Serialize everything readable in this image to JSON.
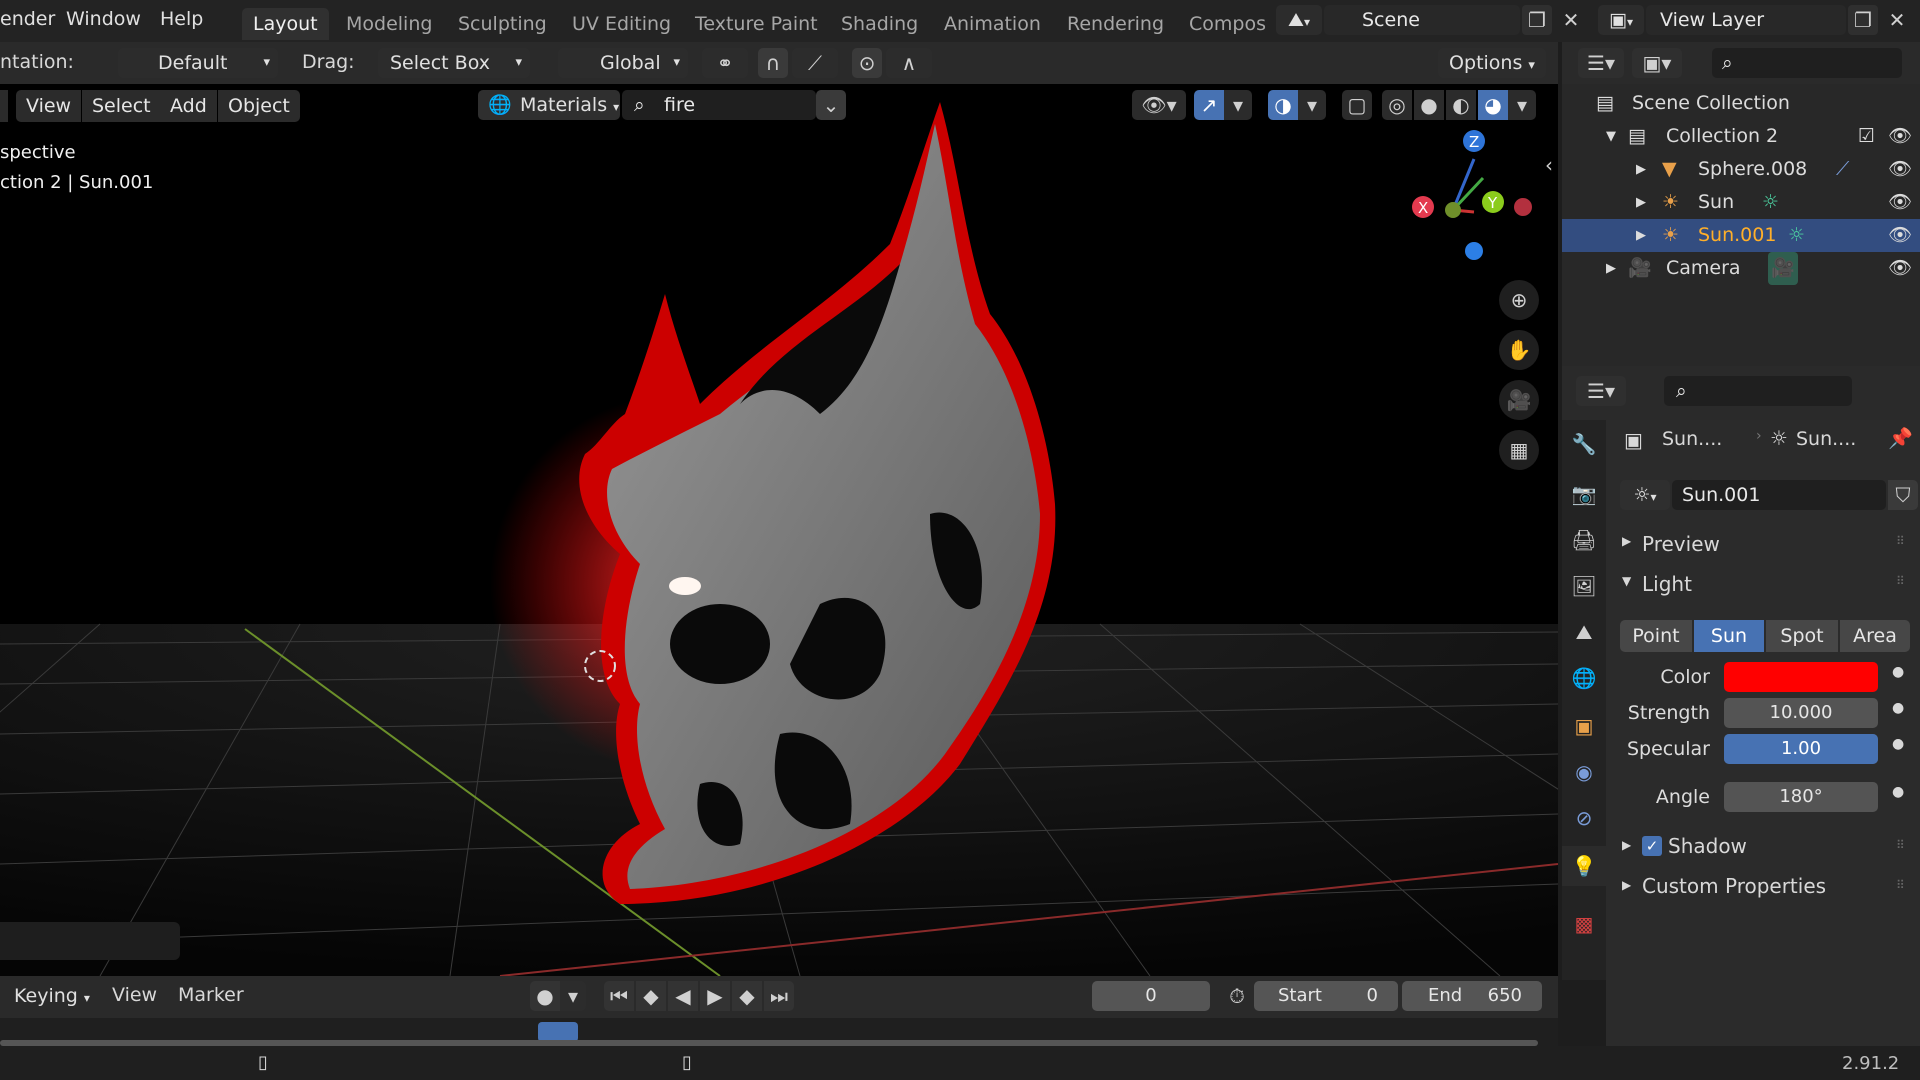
{
  "menu": {
    "render": "ender",
    "window": "Window",
    "help": "Help"
  },
  "workspaces": [
    "Layout",
    "Modeling",
    "Sculpting",
    "UV Editing",
    "Texture Paint",
    "Shading",
    "Animation",
    "Rendering",
    "Compos"
  ],
  "scene": {
    "label": "Scene"
  },
  "view_layer": {
    "label": "View Layer"
  },
  "toolbar": {
    "orientation_label": "ntation:",
    "orientation_value": "Default",
    "drag_label": "Drag:",
    "drag_value": "Select Box",
    "transform": "Global",
    "options": "Options"
  },
  "viewport_header": {
    "view": "View",
    "select": "Select",
    "add": "Add",
    "object": "Object",
    "material_mode": "Materials",
    "search_value": "fire"
  },
  "viewport_overlay": {
    "line1": "spective",
    "line2": "ction 2 | Sun.001"
  },
  "gizmo": {
    "x": "X",
    "y": "Y",
    "z": "Z"
  },
  "outliner": {
    "items": [
      {
        "label": "Scene Collection"
      },
      {
        "label": "Collection 2"
      },
      {
        "label": "Sphere.008"
      },
      {
        "label": "Sun"
      },
      {
        "label": "Sun.001"
      },
      {
        "label": "Camera"
      }
    ]
  },
  "properties": {
    "breadcrumb_object": "Sun....",
    "breadcrumb_data": "Sun....",
    "datablock_name": "Sun.001",
    "panels": {
      "preview": "Preview",
      "light": "Light",
      "shadow": "Shadow",
      "custom_properties": "Custom Properties"
    },
    "light_types": [
      "Point",
      "Sun",
      "Spot",
      "Area"
    ],
    "active_light_type": "Sun",
    "fields": {
      "color_label": "Color",
      "color_value": "#ff0000",
      "strength_label": "Strength",
      "strength_value": "10.000",
      "specular_label": "Specular",
      "specular_value": "1.00",
      "specular_fraction": 1.0,
      "angle_label": "Angle",
      "angle_value": "180°"
    },
    "shadow_enabled": true
  },
  "timeline": {
    "keying": "Keying",
    "view": "View",
    "marker": "Marker",
    "current_frame": "0",
    "start_label": "Start",
    "start_value": "0",
    "end_label": "End",
    "end_value": "650"
  },
  "statusbar": {
    "version": "2.91.2"
  },
  "colors": {
    "accent_blue": "#4772b3",
    "light_red": "#ff0000",
    "selection_row": "#334d80"
  }
}
